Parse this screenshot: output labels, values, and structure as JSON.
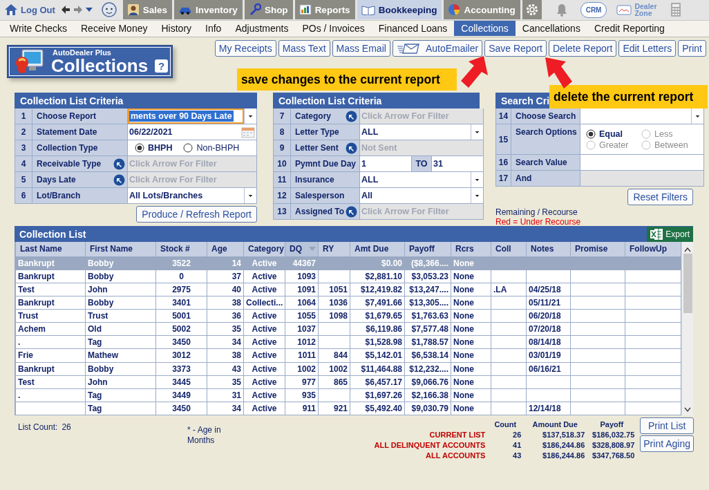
{
  "top_nav": [
    {
      "kind": "link",
      "label": "Log Out"
    },
    {
      "kind": "history"
    },
    {
      "kind": "avatar"
    },
    {
      "kind": "tab",
      "label": "Sales",
      "selected": false
    },
    {
      "kind": "tab",
      "label": "Inventory",
      "selected": false
    },
    {
      "kind": "tab",
      "label": "Shop",
      "selected": false
    },
    {
      "kind": "tab",
      "label": "Reports",
      "selected": false
    },
    {
      "kind": "tab",
      "label": "Bookkeeping",
      "selected": true
    },
    {
      "kind": "tab",
      "label": "Accounting",
      "selected": false
    },
    {
      "kind": "settings"
    },
    {
      "kind": "bell"
    },
    {
      "kind": "crm",
      "label": "CRM"
    },
    {
      "kind": "zone",
      "label": "Dealer Zone"
    },
    {
      "kind": "calculator"
    }
  ],
  "sub_nav": [
    {
      "label": "Write Checks",
      "selected": false
    },
    {
      "label": "Receive Money",
      "selected": false
    },
    {
      "label": "History",
      "selected": false
    },
    {
      "label": "Info",
      "selected": false
    },
    {
      "label": "Adjustments",
      "selected": false
    },
    {
      "label": "POs / Invoices",
      "selected": false
    },
    {
      "label": "Financed Loans",
      "selected": false
    },
    {
      "label": "Collections",
      "selected": true
    },
    {
      "label": "Cancellations",
      "selected": false
    },
    {
      "label": "Credit Reporting",
      "selected": false
    }
  ],
  "title_badge": {
    "brand": "AutoDealer Plus",
    "title": "Collections",
    "help": "?"
  },
  "toolbar": [
    {
      "label": "My Receipts",
      "kind": "plain"
    },
    {
      "label": "Mass Text",
      "kind": "plain"
    },
    {
      "label": "Mass Email",
      "kind": "plain"
    },
    {
      "label": "AutoEmailer",
      "kind": "mail"
    },
    {
      "label": "Save Report",
      "kind": "plain"
    },
    {
      "label": "Delete Report",
      "kind": "plain"
    },
    {
      "label": "Edit Letters",
      "kind": "plain"
    },
    {
      "label": "Print",
      "kind": "plain"
    }
  ],
  "callouts": [
    {
      "text": "save changes to the current report"
    },
    {
      "text": "delete the current report"
    }
  ],
  "criteria_panels": [
    {
      "title": "Collection List Criteria",
      "rows": [
        {
          "num": "1",
          "label": "Choose Report",
          "kind": "select",
          "value": "ments over 90 Days Late",
          "focused": true
        },
        {
          "num": "2",
          "label": "Statement Date",
          "kind": "date",
          "value": "06/22/2021"
        },
        {
          "num": "3",
          "label": "Collection Type",
          "kind": "radio",
          "options": [
            {
              "label": "BHPH",
              "selected": true,
              "disabled": false
            },
            {
              "label": "Non-BHPH",
              "selected": false,
              "disabled": false
            }
          ]
        },
        {
          "num": "4",
          "label": "Receivable Type",
          "kind": "filter",
          "placeholder": "Click Arrow For Filter"
        },
        {
          "num": "5",
          "label": "Days Late",
          "kind": "filter",
          "placeholder": "Click Arrow For Filter"
        },
        {
          "num": "6",
          "label": "Lot/Branch",
          "kind": "select",
          "value": "All Lots/Branches",
          "focused": false
        }
      ],
      "button": "Produce / Refresh Report"
    },
    {
      "title": "Collection List Criteria",
      "rows": [
        {
          "num": "7",
          "label": "Category",
          "kind": "filter",
          "placeholder": "Click Arrow For Filter"
        },
        {
          "num": "8",
          "label": "Letter Type",
          "kind": "select",
          "value": "ALL",
          "focused": false
        },
        {
          "num": "9",
          "label": "Letter Sent",
          "kind": "filter",
          "placeholder": "Not Sent"
        },
        {
          "num": "10",
          "label": "Pymnt Due Day",
          "kind": "range",
          "from": "1",
          "to_label": "TO",
          "to": "31"
        },
        {
          "num": "11",
          "label": "Insurance",
          "kind": "select",
          "value": "ALL",
          "focused": false
        },
        {
          "num": "12",
          "label": "Salesperson",
          "kind": "select",
          "value": "All",
          "focused": false
        },
        {
          "num": "13",
          "label": "Assigned To",
          "kind": "filter",
          "placeholder": "Click Arrow For Filter"
        }
      ]
    },
    {
      "title": "Search Cri",
      "rows": [
        {
          "num": "14",
          "label": "Choose Search",
          "kind": "select",
          "focused": false
        },
        {
          "num": "15",
          "label": "Search Options",
          "kind": "radio",
          "options": [
            {
              "label": "Equal",
              "selected": true,
              "disabled": false
            },
            {
              "label": "Less",
              "selected": false,
              "disabled": true
            },
            {
              "label": "Greater",
              "selected": false,
              "disabled": true
            },
            {
              "label": "Between",
              "selected": false,
              "disabled": true
            }
          ]
        },
        {
          "num": "16",
          "label": "Search Value",
          "kind": "text",
          "disabled": false
        },
        {
          "num": "17",
          "label": "And",
          "kind": "text",
          "disabled": true
        }
      ],
      "button": "Reset Filters",
      "legend": [
        {
          "text": "Remaining / Recourse",
          "kind": "normal"
        },
        {
          "text": "Red = Under Recourse",
          "kind": "alert"
        }
      ]
    }
  ],
  "table": {
    "title": "Collection List",
    "export": "Export",
    "columns": [
      {
        "label": "Last Name",
        "sorted": false
      },
      {
        "label": "First Name",
        "sorted": false
      },
      {
        "label": "Stock #",
        "sorted": false
      },
      {
        "label": "Age",
        "sorted": false
      },
      {
        "label": "Category",
        "sorted": false
      },
      {
        "label": "DQ",
        "sorted": true
      },
      {
        "label": "RY",
        "sorted": false
      },
      {
        "label": "Amt Due",
        "sorted": false
      },
      {
        "label": "Payoff",
        "sorted": false
      },
      {
        "label": "Rcrs",
        "sorted": false
      },
      {
        "label": "Coll",
        "sorted": false
      },
      {
        "label": "Notes",
        "sorted": false
      },
      {
        "label": "Promise",
        "sorted": false
      },
      {
        "label": "FollowUp",
        "sorted": false
      }
    ],
    "rows": [
      {
        "selected": true,
        "cells": [
          "Bankrupt",
          "Bobby",
          "3522",
          "14",
          "Active",
          "44367",
          null,
          "$0.00",
          "($8,366....",
          "None",
          null,
          null,
          null,
          null
        ]
      },
      {
        "selected": false,
        "cells": [
          "Bankrupt",
          "Bobby",
          "0",
          "37",
          "Active",
          "1093",
          null,
          "$2,881.10",
          "$3,053.23",
          "None",
          null,
          null,
          null,
          null
        ]
      },
      {
        "selected": false,
        "cells": [
          "Test",
          "John",
          "2975",
          "40",
          "Active",
          "1091",
          "1051",
          "$12,419.82",
          "$13,247....",
          "None",
          ".LA",
          "04/25/18",
          null,
          null
        ]
      },
      {
        "selected": false,
        "cells": [
          "Bankrupt",
          "Bobby",
          "3401",
          "38",
          "Collecti...",
          "1064",
          "1036",
          "$7,491.66",
          "$13,305....",
          "None",
          null,
          "05/11/21",
          null,
          null
        ]
      },
      {
        "selected": false,
        "cells": [
          "Trust",
          "Trust",
          "5001",
          "36",
          "Active",
          "1055",
          "1098",
          "$1,679.65",
          "$1,763.63",
          "None",
          null,
          "06/20/18",
          null,
          null
        ]
      },
      {
        "selected": false,
        "cells": [
          "Achem",
          "Old",
          "5002",
          "35",
          "Active",
          "1037",
          null,
          "$6,119.86",
          "$7,577.48",
          "None",
          null,
          "07/20/18",
          null,
          null
        ]
      },
      {
        "selected": false,
        "cells": [
          ".",
          "Tag",
          "3450",
          "34",
          "Active",
          "1012",
          null,
          "$1,528.98",
          "$1,788.57",
          "None",
          null,
          "08/14/18",
          null,
          null
        ]
      },
      {
        "selected": false,
        "cells": [
          "Frie",
          "Mathew",
          "3012",
          "38",
          "Active",
          "1011",
          "844",
          "$5,142.01",
          "$6,538.14",
          "None",
          null,
          "03/01/19",
          null,
          null
        ]
      },
      {
        "selected": false,
        "cells": [
          "Bankrupt",
          "Bobby",
          "3373",
          "43",
          "Active",
          "1002",
          "1002",
          "$11,464.88",
          "$12,232....",
          "None",
          null,
          "06/16/21",
          null,
          null
        ]
      },
      {
        "selected": false,
        "cells": [
          "Test",
          "John",
          "3445",
          "35",
          "Active",
          "977",
          "865",
          "$6,457.17",
          "$9,066.76",
          "None",
          null,
          null,
          null,
          null
        ]
      },
      {
        "selected": false,
        "cells": [
          ".",
          "Tag",
          "3449",
          "31",
          "Active",
          "935",
          null,
          "$1,697.26",
          "$2,166.38",
          "None",
          null,
          null,
          null,
          null
        ]
      },
      {
        "selected": false,
        "cells": [
          null,
          "Tag",
          "3450",
          "34",
          "Active",
          "911",
          "921",
          "$5,492.40",
          "$9,030.79",
          "None",
          null,
          "12/14/18",
          null,
          null
        ]
      }
    ]
  },
  "footer": {
    "list_count_label": "List Count:",
    "list_count": "26",
    "note": "* - Age in Months",
    "summary_columns": [
      "Count",
      "Amount Due",
      "Payoff"
    ],
    "summary_rows": [
      {
        "label": "CURRENT LIST",
        "count": "26",
        "amount_due": "$137,518.37",
        "payoff": "$186,032.75"
      },
      {
        "label": "ALL DELINQUENT ACCOUNTS",
        "count": "41",
        "amount_due": "$186,244.86",
        "payoff": "$328,808.97"
      },
      {
        "label": "ALL ACCOUNTS",
        "count": "43",
        "amount_due": "$186,244.86",
        "payoff": "$347,768.50"
      }
    ],
    "buttons": [
      "Print List",
      "Print Aging"
    ]
  }
}
